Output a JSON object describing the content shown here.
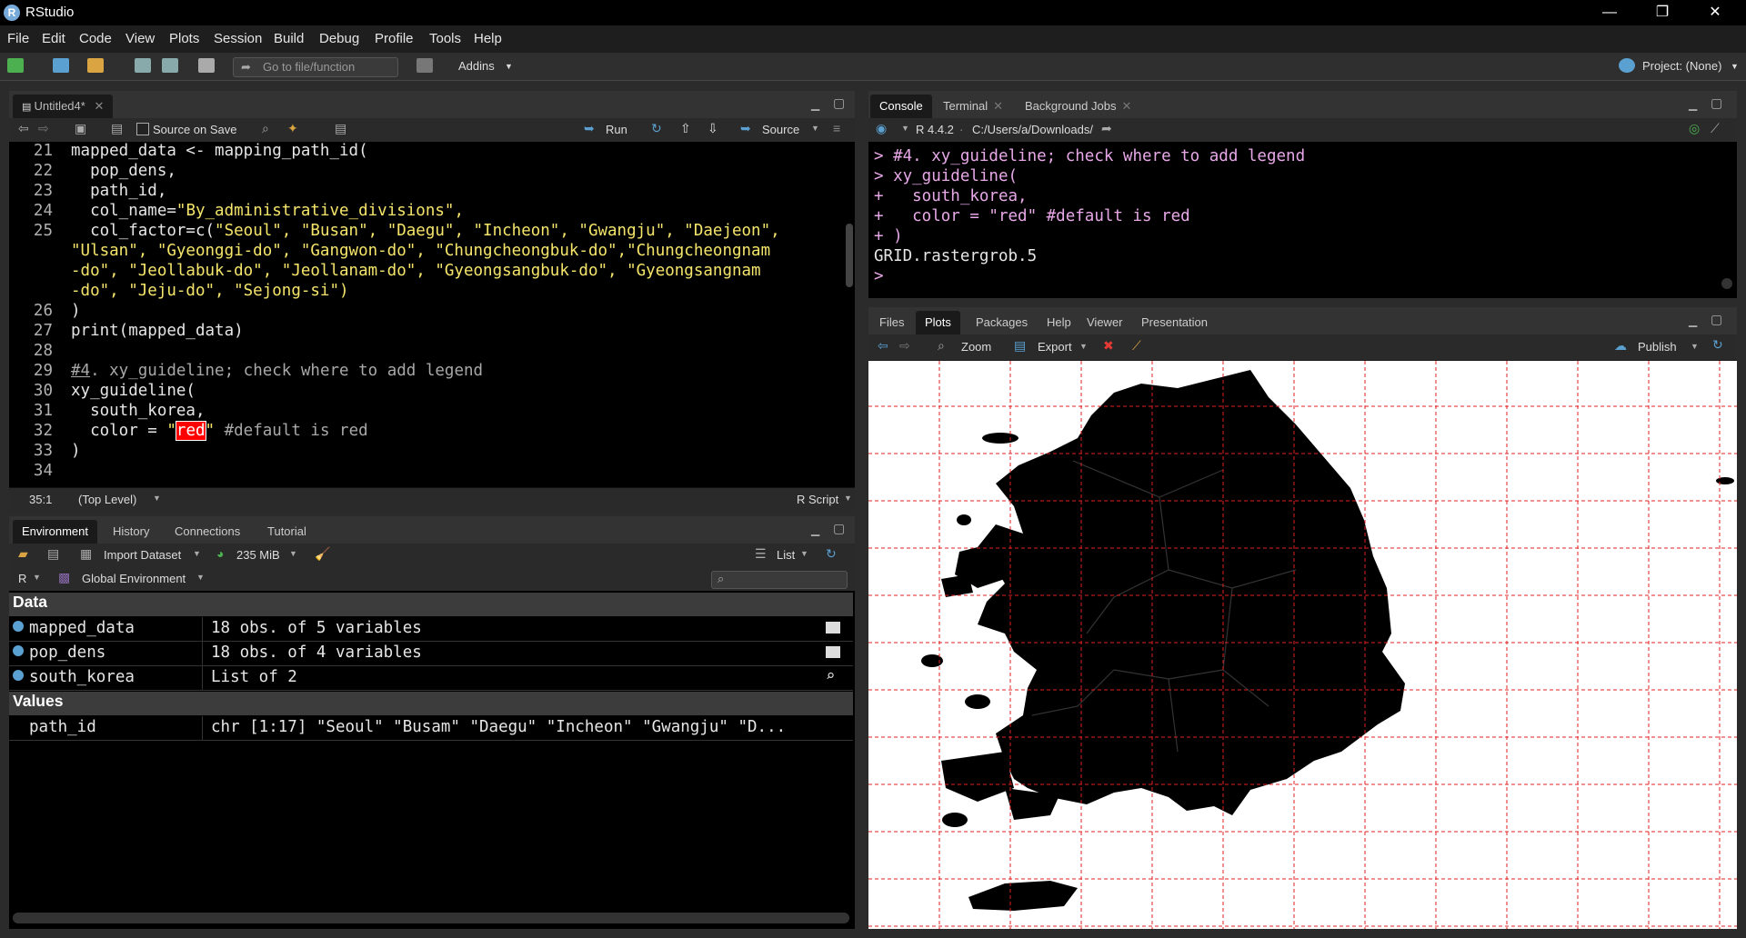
{
  "window": {
    "title": "RStudio",
    "controls": [
      "—",
      "❐",
      "✕"
    ]
  },
  "menu": [
    "File",
    "Edit",
    "Code",
    "View",
    "Plots",
    "Session",
    "Build",
    "Debug",
    "Profile",
    "Tools",
    "Help"
  ],
  "toolbar": {
    "goto_placeholder": "Go to file/function",
    "addins": "Addins",
    "project": "Project: (None)"
  },
  "editor": {
    "tab": "Untitled4*",
    "source_on_save": "Source on Save",
    "run": "Run",
    "source": "Source",
    "status_pos": "35:1",
    "status_scope": "(Top Level)",
    "status_type": "R Script",
    "line_numbers": [
      "21",
      "22",
      "23",
      "24",
      "25",
      "",
      "",
      "",
      "26",
      "27",
      "28",
      "29",
      "30",
      "31",
      "32",
      "33",
      "34"
    ],
    "lines": [
      "mapped_data <- mapping_path_id(",
      "  pop_dens,",
      "  path_id,",
      "  col_name=",
      "  col_factor=c(",
      "",
      "",
      "",
      ")",
      "print(mapped_data)",
      "",
      "",
      "xy_guideline(",
      "  south_korea,",
      "  color = ",
      ")",
      ""
    ],
    "str_col_name": "\"By_administrative_divisions\",",
    "str_cf1": "\"Seoul\", \"Busan\", \"Daegu\", \"Incheon\", \"Gwangju\", \"Daejeon\",",
    "str_cf2": "\"Ulsan\", \"Gyeonggi-do\", \"Gangwon-do\", \"Chungcheongbuk-do\",\"Chungcheongnam",
    "str_cf3": "-do\", \"Jeollabuk-do\", \"Jeollanam-do\", \"Gyeongsangbuk-do\", \"Gyeongsangnam",
    "str_cf4": "-do\", \"Jeju-do\", \"Sejong-si\")",
    "cmt_hash": "#4",
    "cmt_rest": ". xy_guideline; check where to add legend",
    "str_red_q1": "\"",
    "str_red": "red",
    "str_red_q2": "\"",
    "cmt_default": " #default is red"
  },
  "console": {
    "tabs": [
      "Console",
      "Terminal",
      "Background Jobs"
    ],
    "r_version": "R 4.4.2",
    "path": "C:/Users/a/Downloads/",
    "lines": [
      "> #4. xy_guideline; check where to add legend",
      "> xy_guideline(",
      "+   south_korea,",
      "+   color = \"red\" #default is red",
      "+ )",
      "GRID.rastergrob.5",
      "> "
    ]
  },
  "environment": {
    "tabs": [
      "Environment",
      "History",
      "Connections",
      "Tutorial"
    ],
    "import_dataset": "Import Dataset",
    "memory": "235 MiB",
    "view_mode": "List",
    "language": "R",
    "scope": "Global Environment",
    "sections": {
      "data": "Data",
      "values": "Values"
    },
    "data_rows": [
      {
        "name": "mapped_data",
        "value": "18 obs. of 5 variables"
      },
      {
        "name": "pop_dens",
        "value": "18 obs. of 4 variables"
      },
      {
        "name": "south_korea",
        "value": "List of  2"
      }
    ],
    "value_rows": [
      {
        "name": "path_id",
        "value": "chr [1:17] \"Seoul\" \"Busam\" \"Daegu\" \"Incheon\" \"Gwangju\" \"D..."
      }
    ]
  },
  "files_pane": {
    "tabs": [
      "Files",
      "Plots",
      "Packages",
      "Help",
      "Viewer",
      "Presentation"
    ],
    "zoom": "Zoom",
    "export": "Export",
    "publish": "Publish"
  },
  "plot": {
    "grid_color": "#e02020",
    "map_color": "#000000"
  },
  "colors": {
    "string": "#f5e56b",
    "comment": "#a8a8a8",
    "console_input": "#e8a8e8",
    "highlight": "#ff0000"
  }
}
